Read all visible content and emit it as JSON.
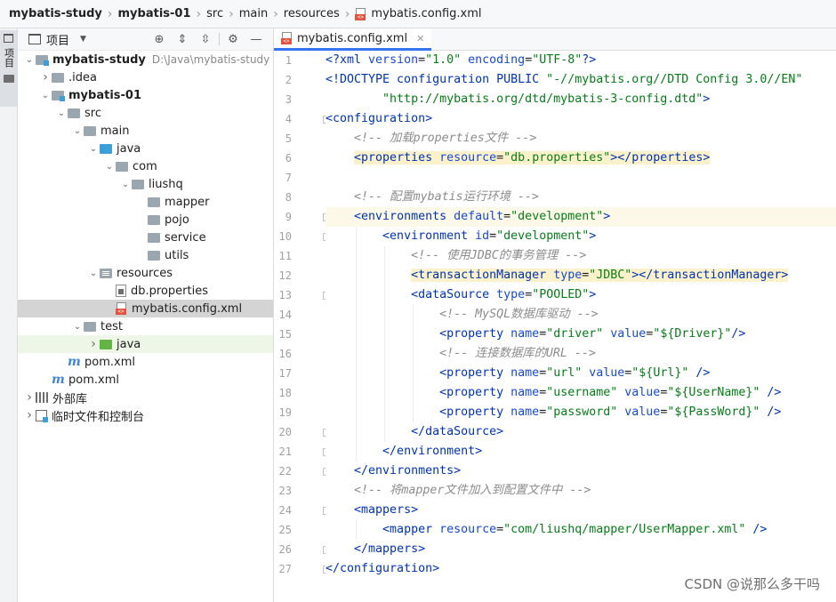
{
  "breadcrumb": [
    {
      "label": "mybatis-study",
      "bold": true
    },
    {
      "label": "mybatis-01",
      "bold": true
    },
    {
      "label": "src",
      "bold": false
    },
    {
      "label": "main",
      "bold": false
    },
    {
      "label": "resources",
      "bold": false
    },
    {
      "label": "mybatis.config.xml",
      "bold": false
    }
  ],
  "toolstrip": {
    "tab_label": "项目"
  },
  "project_panel": {
    "title": "项目",
    "tools": [
      "crosshair-icon",
      "expand-all-icon",
      "collapse-all-icon",
      "gear-icon",
      "minimize-icon"
    ]
  },
  "tree": [
    {
      "label": "mybatis-study",
      "path": "D:\\Java\\mybatis-study",
      "depth": 0,
      "arrow": "down",
      "icon": "module",
      "bold": true
    },
    {
      "label": ".idea",
      "depth": 1,
      "arrow": "right",
      "icon": "folder"
    },
    {
      "label": "mybatis-01",
      "depth": 1,
      "arrow": "down",
      "icon": "module",
      "bold": true
    },
    {
      "label": "src",
      "depth": 2,
      "arrow": "down",
      "icon": "folder"
    },
    {
      "label": "main",
      "depth": 3,
      "arrow": "down",
      "icon": "folder"
    },
    {
      "label": "java",
      "depth": 4,
      "arrow": "down",
      "icon": "blue"
    },
    {
      "label": "com",
      "depth": 5,
      "arrow": "down",
      "icon": "folder"
    },
    {
      "label": "liushq",
      "depth": 6,
      "arrow": "down",
      "icon": "folder"
    },
    {
      "label": "mapper",
      "depth": 7,
      "arrow": "",
      "icon": "folder"
    },
    {
      "label": "pojo",
      "depth": 7,
      "arrow": "",
      "icon": "folder"
    },
    {
      "label": "service",
      "depth": 7,
      "arrow": "",
      "icon": "folder"
    },
    {
      "label": "utils",
      "depth": 7,
      "arrow": "",
      "icon": "folder"
    },
    {
      "label": "resources",
      "depth": 4,
      "arrow": "down",
      "icon": "res"
    },
    {
      "label": "db.properties",
      "depth": 5,
      "arrow": "",
      "icon": "props"
    },
    {
      "label": "mybatis.config.xml",
      "depth": 5,
      "arrow": "",
      "icon": "xml",
      "selected": true
    },
    {
      "label": "test",
      "depth": 3,
      "arrow": "down",
      "icon": "folder"
    },
    {
      "label": "java",
      "depth": 4,
      "arrow": "right",
      "icon": "green",
      "hl": true
    },
    {
      "label": "pom.xml",
      "depth": 2,
      "arrow": "",
      "icon": "maven"
    },
    {
      "label": "pom.xml",
      "depth": 1,
      "arrow": "",
      "icon": "maven"
    },
    {
      "label": "外部库",
      "depth": 0,
      "arrow": "right",
      "icon": "lib"
    },
    {
      "label": "临时文件和控制台",
      "depth": 0,
      "arrow": "right",
      "icon": "scratch"
    }
  ],
  "editor": {
    "tab_label": "mybatis.config.xml",
    "current_line": 9,
    "lines": [
      [
        [
          "pi",
          "<?xml "
        ],
        [
          "attr",
          "version"
        ],
        [
          "punct",
          "="
        ],
        [
          "val",
          "\"1.0\""
        ],
        [
          "attr",
          " encoding"
        ],
        [
          "punct",
          "="
        ],
        [
          "val",
          "\"UTF-8\""
        ],
        [
          "pi",
          "?>"
        ]
      ],
      [
        [
          "tag",
          "<!DOCTYPE configuration PUBLIC "
        ],
        [
          "val",
          "\"-//mybatis.org//DTD Config 3.0//EN\""
        ]
      ],
      [
        [
          "val",
          "        \"http://mybatis.org/dtd/mybatis-3-config.dtd\""
        ],
        [
          "tag",
          ">"
        ]
      ],
      [
        [
          "tag",
          "<configuration>"
        ]
      ],
      [
        [
          "pad",
          "    "
        ],
        [
          "cmt",
          "<!-- 加载properties文件 -->"
        ]
      ],
      [
        [
          "pad",
          "    "
        ],
        [
          "hltag",
          "<properties "
        ],
        [
          "hlattr",
          "resource"
        ],
        [
          "hlpunct",
          "="
        ],
        [
          "hlval",
          "\"db.properties\""
        ],
        [
          "hltag",
          "></properties>"
        ]
      ],
      [],
      [
        [
          "pad",
          "    "
        ],
        [
          "cmt",
          "<!-- 配置mybatis运行环境 -->"
        ]
      ],
      [
        [
          "pad",
          "    "
        ],
        [
          "tag",
          "<environments "
        ],
        [
          "attr",
          "default"
        ],
        [
          "punct",
          "="
        ],
        [
          "val",
          "\"development\""
        ],
        [
          "tag",
          ">"
        ]
      ],
      [
        [
          "pad",
          "        "
        ],
        [
          "tag",
          "<environment "
        ],
        [
          "attr",
          "id"
        ],
        [
          "punct",
          "="
        ],
        [
          "val",
          "\"development\""
        ],
        [
          "tag",
          ">"
        ]
      ],
      [
        [
          "pad",
          "            "
        ],
        [
          "cmt",
          "<!-- 使用JDBC的事务管理 -->"
        ]
      ],
      [
        [
          "pad",
          "            "
        ],
        [
          "hltag",
          "<transactionManager "
        ],
        [
          "hlattr",
          "type"
        ],
        [
          "hlpunct",
          "="
        ],
        [
          "hlval",
          "\"JDBC\""
        ],
        [
          "hltag",
          "></transactionManager>"
        ]
      ],
      [
        [
          "pad",
          "            "
        ],
        [
          "tag",
          "<dataSource "
        ],
        [
          "attr",
          "type"
        ],
        [
          "punct",
          "="
        ],
        [
          "val",
          "\"POOLED\""
        ],
        [
          "tag",
          ">"
        ]
      ],
      [
        [
          "pad",
          "                "
        ],
        [
          "cmt",
          "<!-- MySQL数据库驱动 -->"
        ]
      ],
      [
        [
          "pad",
          "                "
        ],
        [
          "tag",
          "<property "
        ],
        [
          "attr",
          "name"
        ],
        [
          "punct",
          "="
        ],
        [
          "val",
          "\"driver\""
        ],
        [
          "attr",
          " value"
        ],
        [
          "punct",
          "="
        ],
        [
          "val",
          "\"${Driver}\""
        ],
        [
          "tag",
          "/>"
        ]
      ],
      [
        [
          "pad",
          "                "
        ],
        [
          "cmt",
          "<!-- 连接数据库的URL -->"
        ]
      ],
      [
        [
          "pad",
          "                "
        ],
        [
          "tag",
          "<property "
        ],
        [
          "attr",
          "name"
        ],
        [
          "punct",
          "="
        ],
        [
          "val",
          "\"url\""
        ],
        [
          "attr",
          " value"
        ],
        [
          "punct",
          "="
        ],
        [
          "val",
          "\"${Url}\""
        ],
        [
          "tag",
          " />"
        ]
      ],
      [
        [
          "pad",
          "                "
        ],
        [
          "tag",
          "<property "
        ],
        [
          "attr",
          "name"
        ],
        [
          "punct",
          "="
        ],
        [
          "val",
          "\"username\""
        ],
        [
          "attr",
          " value"
        ],
        [
          "punct",
          "="
        ],
        [
          "val",
          "\"${UserName}\""
        ],
        [
          "tag",
          " />"
        ]
      ],
      [
        [
          "pad",
          "                "
        ],
        [
          "tag",
          "<property "
        ],
        [
          "attr",
          "name"
        ],
        [
          "punct",
          "="
        ],
        [
          "val",
          "\"password\""
        ],
        [
          "attr",
          " value"
        ],
        [
          "punct",
          "="
        ],
        [
          "val",
          "\"${PassWord}\""
        ],
        [
          "tag",
          " />"
        ]
      ],
      [
        [
          "pad",
          "            "
        ],
        [
          "tag",
          "</dataSource>"
        ]
      ],
      [
        [
          "pad",
          "        "
        ],
        [
          "tag",
          "</environment>"
        ]
      ],
      [
        [
          "pad",
          "    "
        ],
        [
          "tag",
          "</environments>"
        ]
      ],
      [
        [
          "pad",
          "    "
        ],
        [
          "cmt",
          "<!-- 将mapper文件加入到配置文件中 -->"
        ]
      ],
      [
        [
          "pad",
          "    "
        ],
        [
          "tag",
          "<mappers>"
        ]
      ],
      [
        [
          "pad",
          "        "
        ],
        [
          "tag",
          "<mapper "
        ],
        [
          "attr",
          "resource"
        ],
        [
          "punct",
          "="
        ],
        [
          "val",
          "\"com/liushq/mapper/UserMapper.xml\""
        ],
        [
          "tag",
          " />"
        ]
      ],
      [
        [
          "pad",
          "    "
        ],
        [
          "tag",
          "</mappers>"
        ]
      ],
      [
        [
          "tag",
          "</configuration>"
        ]
      ]
    ],
    "fold_lines": [
      4,
      9,
      10,
      13,
      20,
      21,
      22,
      24,
      26,
      27
    ]
  },
  "watermark": "CSDN @说那么多干吗"
}
